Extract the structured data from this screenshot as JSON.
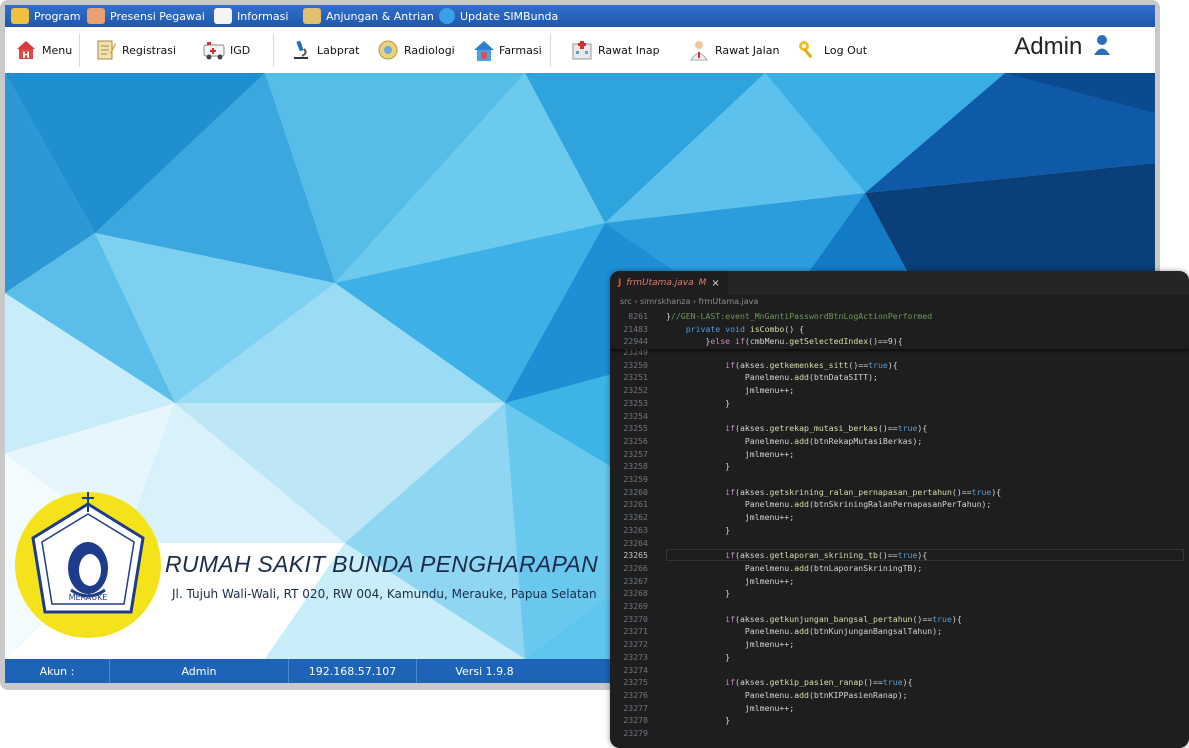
{
  "menubar": {
    "items": [
      {
        "label": "Program",
        "icon": "program-icon"
      },
      {
        "label": "Presensi Pegawai",
        "icon": "staff-icon"
      },
      {
        "label": "Informasi",
        "icon": "book-icon"
      },
      {
        "label": "Anjungan & Antrian",
        "icon": "queue-icon"
      },
      {
        "label": "Update SIMBunda",
        "icon": "update-icon"
      }
    ]
  },
  "toolbar": {
    "items": [
      {
        "label": "Menu",
        "icon": "home-icon"
      },
      {
        "label": "Registrasi",
        "icon": "registration-icon"
      },
      {
        "label": "IGD",
        "icon": "ambulance-icon"
      },
      {
        "label": "Labprat",
        "icon": "microscope-icon"
      },
      {
        "label": "Radiologi",
        "icon": "radiology-icon"
      },
      {
        "label": "Farmasi",
        "icon": "pharmacy-icon"
      },
      {
        "label": "Rawat Inap",
        "icon": "hospital-icon"
      },
      {
        "label": "Rawat Jalan",
        "icon": "doctor-icon"
      },
      {
        "label": "Log Out",
        "icon": "key-icon"
      }
    ],
    "user": "Admin"
  },
  "hospital": {
    "name": "RUMAH SAKIT BUNDA PENGHARAPAN",
    "address": "Jl. Tujuh Wali-Wali, RT 020, RW 004, Kamundu, Merauke, Papua Selatan",
    "logo_text_arc": "RUMAH SAKIT BUNDA PENGHARAPAN",
    "logo_text_bottom": "MERAUKE"
  },
  "statusbar": {
    "account_label": "Akun :",
    "account": "Admin",
    "ip": "192.168.57.107",
    "version": "Versi 1.9.8"
  },
  "editor": {
    "tab_label": "frmUtama.java",
    "tab_badge": "M",
    "tab_close": "×",
    "breadcrumb": "src  ›  simrskhanza  ›  frmUtama.java",
    "sticky": [
      {
        "n": "8261",
        "code": "}//GEN-LAST:event_MnGantiPasswordBtnLogActionPerformed"
      },
      {
        "n": "21483",
        "code": "    private void isCombo() {"
      },
      {
        "n": "22944",
        "code": "        }else if(cmbMenu.getSelectedIndex()==9){"
      }
    ],
    "lines": [
      {
        "n": "23249",
        "code": ""
      },
      {
        "n": "23250",
        "code": "            if(akses.getkemenkes_sitt()==true){"
      },
      {
        "n": "23251",
        "code": "                Panelmenu.add(btnDataSITT);"
      },
      {
        "n": "23252",
        "code": "                jmlmenu++;"
      },
      {
        "n": "23253",
        "code": "            }"
      },
      {
        "n": "23254",
        "code": ""
      },
      {
        "n": "23255",
        "code": "            if(akses.getrekap_mutasi_berkas()==true){"
      },
      {
        "n": "23256",
        "code": "                Panelmenu.add(btnRekapMutasiBerkas);"
      },
      {
        "n": "23257",
        "code": "                jmlmenu++;"
      },
      {
        "n": "23258",
        "code": "            }"
      },
      {
        "n": "23259",
        "code": ""
      },
      {
        "n": "23260",
        "code": "            if(akses.getskrining_ralan_pernapasan_pertahun()==true){"
      },
      {
        "n": "23261",
        "code": "                Panelmenu.add(btnSkriningRalanPernapasanPerTahun);"
      },
      {
        "n": "23262",
        "code": "                jmlmenu++;"
      },
      {
        "n": "23263",
        "code": "            }"
      },
      {
        "n": "23264",
        "code": ""
      },
      {
        "n": "23265",
        "code": "            if(akses.getlaporan_skrining_tb()==true){"
      },
      {
        "n": "23266",
        "code": "                Panelmenu.add(btnLaporanSkriningTB);"
      },
      {
        "n": "23267",
        "code": "                jmlmenu++;"
      },
      {
        "n": "23268",
        "code": "            }"
      },
      {
        "n": "23269",
        "code": ""
      },
      {
        "n": "23270",
        "code": "            if(akses.getkunjungan_bangsal_pertahun()==true){"
      },
      {
        "n": "23271",
        "code": "                Panelmenu.add(btnKunjunganBangsalTahun);"
      },
      {
        "n": "23272",
        "code": "                jmlmenu++;"
      },
      {
        "n": "23273",
        "code": "            }"
      },
      {
        "n": "23274",
        "code": ""
      },
      {
        "n": "23275",
        "code": "            if(akses.getkip_pasien_ranap()==true){"
      },
      {
        "n": "23276",
        "code": "                Panelmenu.add(btnKIPPasienRanap);"
      },
      {
        "n": "23277",
        "code": "                jmlmenu++;"
      },
      {
        "n": "23278",
        "code": "            }"
      },
      {
        "n": "23279",
        "code": ""
      }
    ],
    "current_line": "23265"
  },
  "colors": {
    "menubar": "#2563c0",
    "statusbar": "#1d63b8",
    "editor_bg": "#1e1e1e",
    "keyword": "#569cd6",
    "function": "#dcdcaa"
  }
}
